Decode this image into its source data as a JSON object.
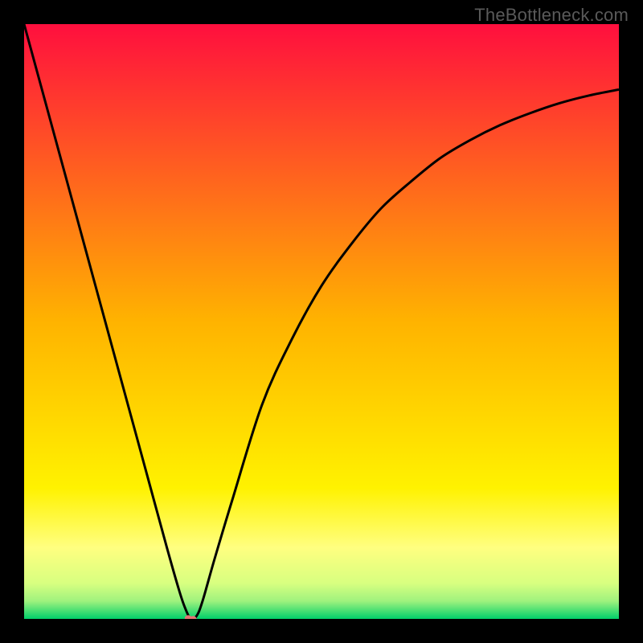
{
  "watermark": "TheBottleneck.com",
  "chart_data": {
    "type": "line",
    "title": "",
    "xlabel": "",
    "ylabel": "",
    "xlim": [
      0,
      100
    ],
    "ylim": [
      0,
      100
    ],
    "grid": false,
    "legend": false,
    "background_gradient": {
      "stops": [
        {
          "offset": 0.0,
          "color": "#ff0f3e"
        },
        {
          "offset": 0.5,
          "color": "#ffb300"
        },
        {
          "offset": 0.78,
          "color": "#fff200"
        },
        {
          "offset": 0.88,
          "color": "#ffff80"
        },
        {
          "offset": 0.94,
          "color": "#d8ff80"
        },
        {
          "offset": 0.97,
          "color": "#9ff27e"
        },
        {
          "offset": 1.0,
          "color": "#00d06a"
        }
      ]
    },
    "series": [
      {
        "name": "bottleneck-curve",
        "color": "#000000",
        "x": [
          0,
          3,
          6,
          9,
          12,
          15,
          18,
          21,
          24,
          26,
          27,
          28,
          29,
          30,
          32,
          35,
          40,
          45,
          50,
          55,
          60,
          65,
          70,
          75,
          80,
          85,
          90,
          95,
          100
        ],
        "y": [
          100,
          89,
          78,
          67,
          56,
          45,
          34,
          23,
          12,
          5,
          2,
          0,
          0.5,
          3,
          10,
          20,
          36,
          47,
          56,
          63,
          69,
          73.5,
          77.5,
          80.5,
          83,
          85,
          86.7,
          88,
          89
        ]
      }
    ],
    "markers": [
      {
        "name": "minimum-marker",
        "x": 28,
        "y": 0,
        "color": "#e57373",
        "size": 8
      }
    ]
  }
}
